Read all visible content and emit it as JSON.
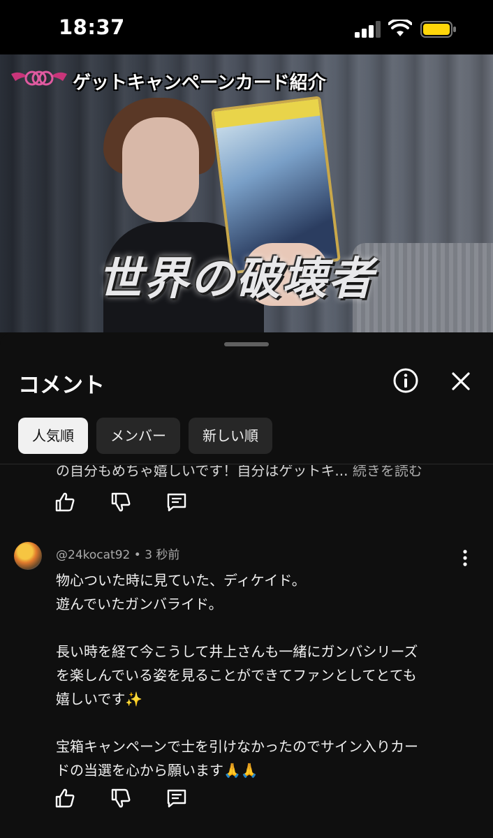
{
  "status": {
    "time": "18:37",
    "battery_color": "#ffd60a"
  },
  "video": {
    "caption": "ゲットキャンペーンカード紹介",
    "title": "世界の破壊者",
    "progress": 0.0,
    "accent": "#ff0000"
  },
  "comments_panel": {
    "title": "コメント",
    "info_icon": "info-circle-icon",
    "close_icon": "close-icon",
    "chips": [
      "人気順",
      "メンバー",
      "新しい順"
    ],
    "active_chip": 0
  },
  "previous_comment": {
    "text_cut": "の自分もめちゃ嬉しいです！自分はゲットキ...",
    "read_more": "続きを読む"
  },
  "comment": {
    "author": "@24kocat92",
    "age": "3 秒前",
    "lines": [
      "物心ついた時に見ていた、ディケイド。",
      "遊んでいたガンバライド。",
      "",
      "長い時を経て今こうして井上さんも一緒にガンバシリーズ",
      "を楽しんでいる姿を見ることができてファンとしてとても",
      "嬉しいです✨",
      "",
      "宝箱キャンペーンで士を引けなかったのでサイン入りカー",
      "ドの当選を心から願います🙏🙏"
    ]
  },
  "icons": [
    "like-icon",
    "dislike-icon",
    "reply-icon",
    "more-vert-icon"
  ]
}
